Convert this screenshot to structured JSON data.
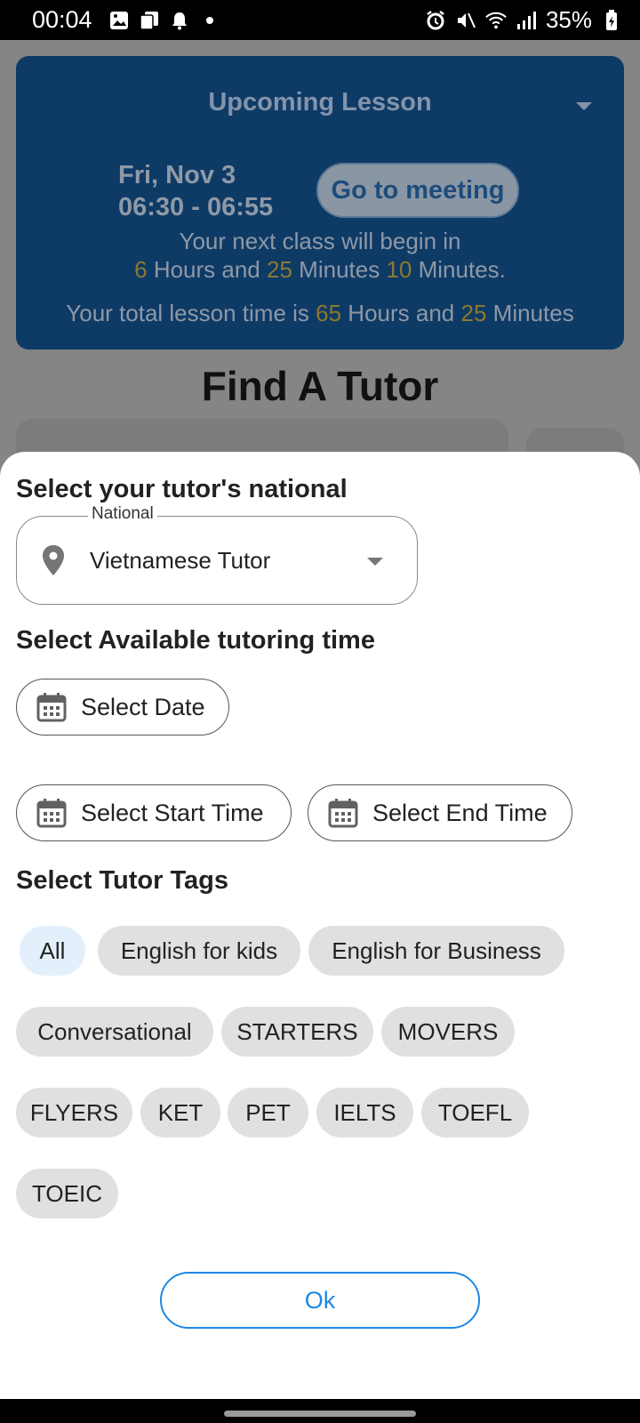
{
  "status_bar": {
    "time": "00:04",
    "battery": "35%",
    "icons_left": [
      "image-icon",
      "copy-icon",
      "bell-icon",
      "dot-icon"
    ],
    "icons_right": [
      "alarm-icon",
      "mute-icon",
      "wifi-icon",
      "signal-icon",
      "battery-icon"
    ]
  },
  "lesson": {
    "title": "Upcoming Lesson",
    "date": "Fri, Nov 3",
    "time_range": "06:30 - 06:55",
    "meeting_button": "Go to meeting",
    "next_class_prefix": "Your next class will begin in",
    "hours_value": "6",
    "hours_label": "Hours and",
    "minutes_value": "25",
    "minutes_label": "Minutes",
    "seconds_value": "10",
    "seconds_label": "Minutes.",
    "total_prefix": "Your total lesson time is",
    "total_hours": "65",
    "total_hours_label": "Hours and",
    "total_minutes": "25",
    "total_minutes_label": "Minutes"
  },
  "page_title": "Find A Tutor",
  "sheet": {
    "national_section_title": "Select your tutor's national",
    "national_field_label": "National",
    "national_value": "Vietnamese Tutor",
    "time_section_title": "Select Available tutoring time",
    "select_date": "Select Date",
    "select_start_time": "Select Start Time",
    "select_end_time": "Select End Time",
    "tags_section_title": "Select Tutor Tags",
    "tags": [
      "All",
      "English for kids",
      "English for Business",
      "Conversational",
      "STARTERS",
      "MOVERS",
      "FLYERS",
      "KET",
      "PET",
      "IELTS",
      "TOEFL",
      "TOEIC"
    ],
    "selected_tag": "All",
    "ok_button": "Ok"
  },
  "colors": {
    "accent": "#1e88e5",
    "lesson_card": "#0e3a66",
    "highlight": "#8c7a2e",
    "chip": "#e0e0e0",
    "chip_selected": "#e3f0fb"
  }
}
